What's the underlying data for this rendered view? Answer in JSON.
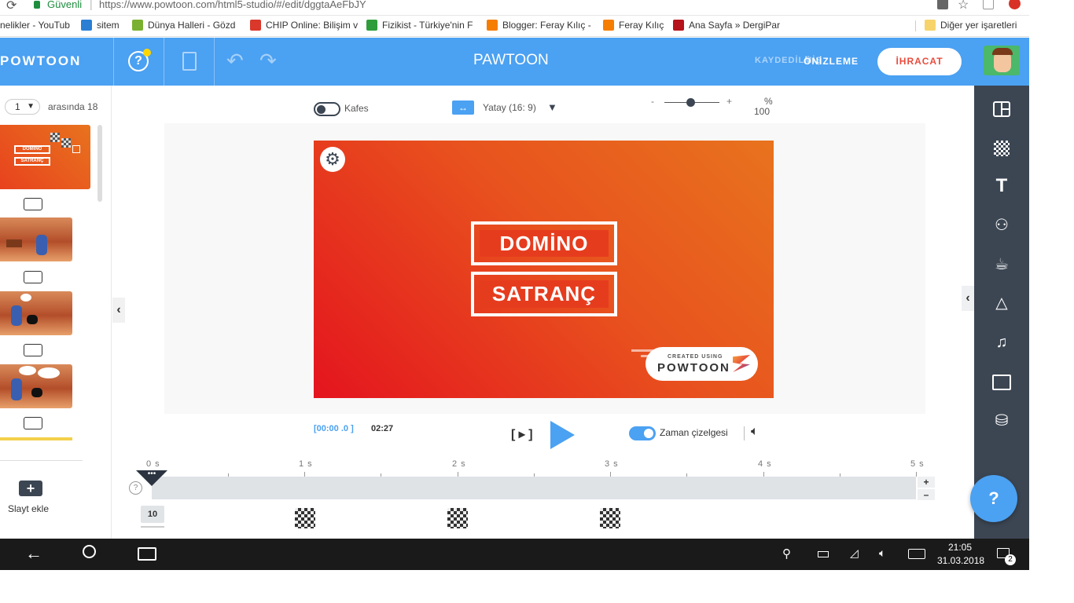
{
  "browser": {
    "secure_label": "Güvenli",
    "url": "https://www.powtoon.com/html5-studio/#/edit/dggtaAeFbJY",
    "bookmarks": [
      {
        "label": "nelikler - YouTub",
        "icon": "youtube-icon",
        "color": "#e62117"
      },
      {
        "label": "sitem",
        "icon": "x-icon",
        "color": "#2a7fd4"
      },
      {
        "label": "Dünya Halleri - Gözd",
        "icon": "globe-icon",
        "color": "#7ab030"
      },
      {
        "label": "CHIP Online: Bilişim v",
        "icon": "chip-icon",
        "color": "#d9382b"
      },
      {
        "label": "Fizikist - Türkiye'nin F",
        "icon": "fizikist-icon",
        "color": "#2f9e3a"
      },
      {
        "label": "Blogger: Feray Kılıç -",
        "icon": "blogger-icon",
        "color": "#f57d00"
      },
      {
        "label": "Feray Kılıç",
        "icon": "blogger-icon",
        "color": "#f57d00"
      },
      {
        "label": "Ana Sayfa » DergiPar",
        "icon": "dp-icon",
        "color": "#b5121b"
      }
    ],
    "other_bookmarks": "Diğer yer işaretleri"
  },
  "header": {
    "logo": "POWTOON",
    "title": "PAWTOON",
    "save_label": "KAYDEDİLMİŞ",
    "preview_label": "ÖNİZLEME",
    "export_label": "İHRACAT"
  },
  "slides_panel": {
    "page_select": "1",
    "page_of": "arasında 18",
    "add_slide": "Slayt ekle"
  },
  "canvas_toolbar": {
    "grid_label": "Kafes",
    "orientation_label": "Yatay (16: 9)",
    "zoom_percent_sign": "%",
    "zoom_value": "100"
  },
  "slide": {
    "word1": "DOMİNO",
    "word2": "SATRANÇ",
    "badge_small": "CREATED USING",
    "badge_large": "POWTOON"
  },
  "playback": {
    "current_time": "[00:00 .0 ]",
    "total_time": "02:27",
    "timeline_toggle_label": "Zaman çizelgesi",
    "timeline_toggle_on": true
  },
  "timeline": {
    "ticks": [
      "0 s",
      "1 s",
      "2 s",
      "3 s",
      "4 s",
      "5 s"
    ],
    "duration_badge": "10"
  },
  "help_button": "?",
  "taskbar": {
    "time": "21:05",
    "date": "31.03.2018",
    "notification_count": "2"
  }
}
